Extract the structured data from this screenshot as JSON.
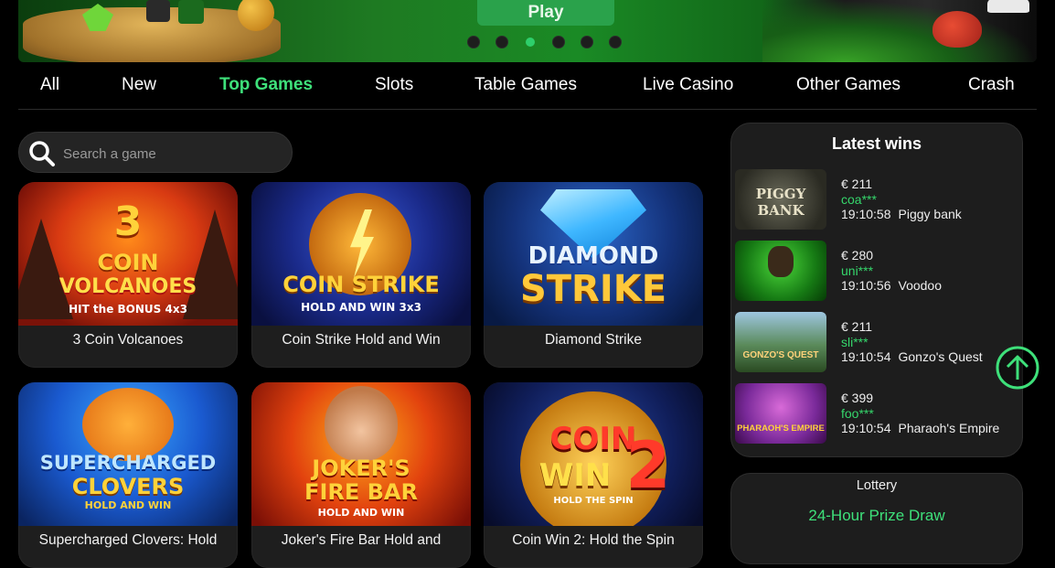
{
  "banner": {
    "play_label": "Play",
    "slide_count": 6,
    "active_slide": 3
  },
  "nav": {
    "tabs": [
      {
        "label": "All"
      },
      {
        "label": "New"
      },
      {
        "label": "Top Games",
        "active": true
      },
      {
        "label": "Slots"
      },
      {
        "label": "Table Games"
      },
      {
        "label": "Live Casino"
      },
      {
        "label": "Other Games"
      },
      {
        "label": "Crash"
      }
    ]
  },
  "search": {
    "placeholder": "Search a game"
  },
  "games": [
    {
      "title": "3 Coin Volcanoes",
      "art": [
        "3",
        "COIN",
        "VOLCANOES",
        "HIT the BONUS 4x3"
      ]
    },
    {
      "title": "Coin Strike Hold and Win",
      "art": [
        "COIN STRIKE",
        "HOLD AND WIN 3x3"
      ]
    },
    {
      "title": "Diamond Strike",
      "art": [
        "DIAMOND",
        "STRIKE"
      ]
    },
    {
      "title": "Supercharged Clovers: Hold",
      "art": [
        "SUPERCHARGED",
        "CLOVERS",
        "HOLD AND WIN"
      ]
    },
    {
      "title": "Joker's Fire Bar Hold and",
      "art": [
        "JOKER'S",
        "FIRE BAR",
        "HOLD AND WIN"
      ]
    },
    {
      "title": "Coin Win 2: Hold the Spin",
      "art": [
        "COIN",
        "WIN",
        "2",
        "HOLD THE SPIN"
      ]
    }
  ],
  "latest_wins": {
    "title": "Latest wins",
    "items": [
      {
        "amount": "€ 211",
        "user": "coa***",
        "time": "19:10:58",
        "game": "Piggy bank",
        "art": "PIGGY BANK"
      },
      {
        "amount": "€ 280",
        "user": "uni***",
        "time": "19:10:56",
        "game": "Voodoo",
        "art": ""
      },
      {
        "amount": "€ 211",
        "user": "sli***",
        "time": "19:10:54",
        "game": "Gonzo's Quest",
        "art": "GONZO'S QUEST"
      },
      {
        "amount": "€ 399",
        "user": "foo***",
        "time": "19:10:54",
        "game": "Pharaoh's Empire",
        "art": "PHARAOH'S EMPIRE"
      }
    ]
  },
  "lottery": {
    "title": "Lottery",
    "prize": "24-Hour Prize Draw"
  },
  "colors": {
    "accent": "#3ee07a",
    "card_bg": "#1e1e1e",
    "page_bg": "#000000"
  }
}
